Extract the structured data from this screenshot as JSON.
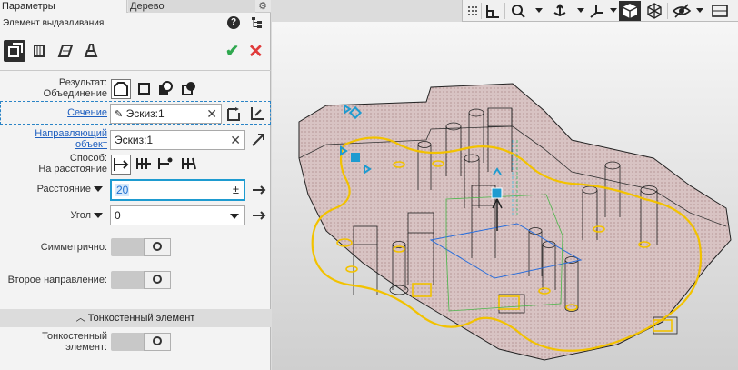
{
  "tabs": [
    {
      "label": "Параметры",
      "active": true
    },
    {
      "label": "Дерево",
      "active": false
    }
  ],
  "header": {
    "operation_title": "Элемент выдавливания"
  },
  "icons": {
    "help": "help-icon",
    "tree": "tree-icon",
    "settings": "gear-icon",
    "ok": "checkmark-icon",
    "cancel": "close-icon"
  },
  "form": {
    "result_label": "Результат:",
    "result_value": "Объединение",
    "section_label": "Сечение",
    "section_value": "Эскиз:1",
    "guide_label": "Направляющий объект",
    "guide_value": "Эскиз:1",
    "method_label": "Способ:",
    "method_value": "На расстояние",
    "distance_label": "Расстояние",
    "distance_value": "20",
    "distance_suffix": "±",
    "angle_label": "Угол",
    "angle_value": "0",
    "symmetric_label": "Симметрично:",
    "second_direction_label": "Второе направление:",
    "thin_section_title": "Тонкостенный элемент",
    "thin_label": "Тонкостенный элемент:"
  },
  "toggles": {
    "symmetric": false,
    "second_direction": false,
    "thin": false
  },
  "colors": {
    "accent": "#1e9bd0",
    "ok": "#2fa84f",
    "cancel": "#e03a3a",
    "sketch": "#f2c200",
    "link": "#1f5fbf"
  }
}
